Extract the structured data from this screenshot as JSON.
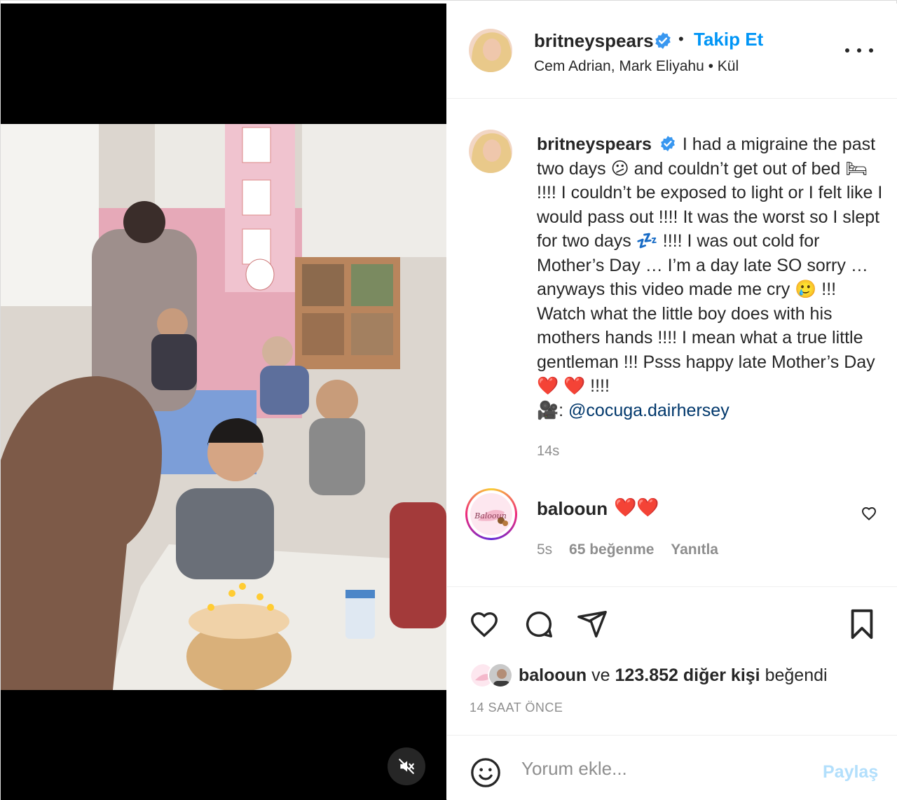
{
  "header": {
    "username": "britneyspears",
    "separator": "•",
    "follow_label": "Takip Et",
    "subtitle": "Cem Adrian, Mark Eliyahu • Kül"
  },
  "caption": {
    "username": "britneyspears",
    "text": "I had a migraine the past two days 😕 and couldn’t get out of bed 🛏 !!!! I couldn’t be exposed to light or I felt like I would pass out !!!! It was the worst so I slept for two days 💤 !!!! I was out cold for Mother’s Day … I’m a day late SO sorry … anyways this video made me cry 🥲 !!! Watch what the little boy does with his mothers hands !!!! I mean what a true little gentleman !!! Psss happy late Mother’s Day ❤️ ❤️ !!!!",
    "credit_prefix": "🎥:",
    "mention": "@cocuga.dairhersey",
    "time": "14s"
  },
  "comment": {
    "username": "balooun",
    "text": "❤️❤️",
    "time": "5s",
    "likes": "65 beğenme",
    "reply_label": "Yanıtla",
    "avatar_text": "Balooun"
  },
  "likes": {
    "user": "balooun",
    "connector": "ve",
    "count_text": "123.852 diğer kişi",
    "suffix": "beğendi"
  },
  "post_time": "14 SAAT ÖNCE",
  "comment_box": {
    "placeholder": "Yorum ekle...",
    "post_label": "Paylaş"
  },
  "colors": {
    "accent": "#0095f6",
    "post_disabled": "#b2dffc",
    "mention": "#00376b",
    "muted": "#8e8e8e"
  },
  "icons": [
    "verified-badge-icon",
    "more-options-icon",
    "heart-icon",
    "comment-bubble-icon",
    "share-icon",
    "bookmark-icon",
    "emoji-icon",
    "muted-speaker-icon"
  ]
}
